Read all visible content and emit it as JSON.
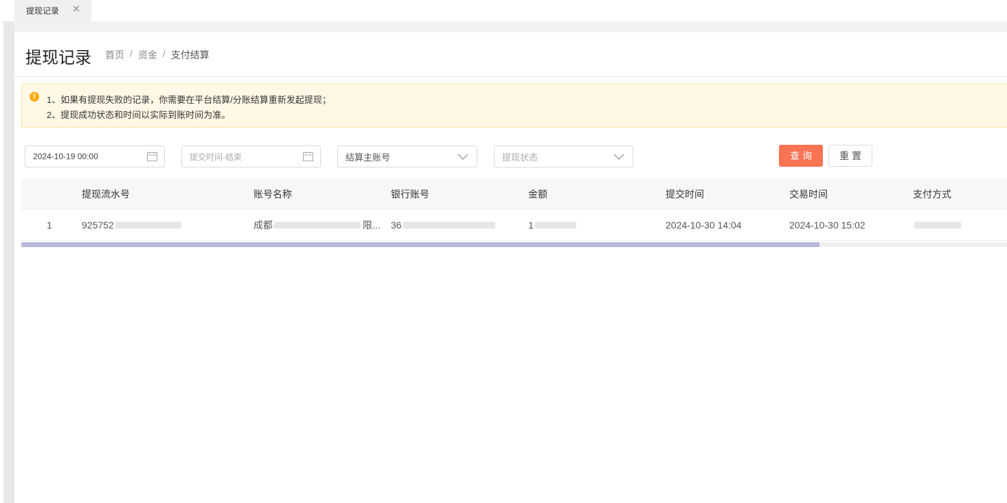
{
  "tab": {
    "label": "提现记录"
  },
  "header": {
    "title": "提现记录",
    "breadcrumb": [
      "首页",
      "资金",
      "支付结算"
    ],
    "separator": "/"
  },
  "notice": {
    "lines": [
      "1、如果有提现失败的记录，你需要在平台结算/分账结算重新发起提现；",
      "2、提现成功状态和时间以实际到账时间为准。"
    ]
  },
  "filters": {
    "start_time": {
      "value": "2024-10-19 00:00"
    },
    "end_time": {
      "placeholder": "提交时间-结束"
    },
    "account_select": {
      "value": "结算主账号"
    },
    "status_select": {
      "placeholder": "提现状态"
    }
  },
  "buttons": {
    "query": "查询",
    "reset": "重置"
  },
  "table": {
    "columns": [
      "提现流水号",
      "账号名称",
      "银行账号",
      "金额",
      "提交时间",
      "交易时间",
      "支付方式"
    ],
    "rows": [
      {
        "index": "1",
        "serial": "925752",
        "account_name": "成都",
        "account_name_tail": "限...",
        "bank_account": "36",
        "amount": "1",
        "submit_time": "2024-10-30 14:04",
        "trade_time": "2024-10-30 15:02",
        "pay_method": ""
      }
    ]
  },
  "scrollbar": {
    "position_fraction": 0.81
  },
  "colors": {
    "primary": "#fa7352",
    "warning": "#faad14",
    "notice_bg": "#fff8e6"
  }
}
